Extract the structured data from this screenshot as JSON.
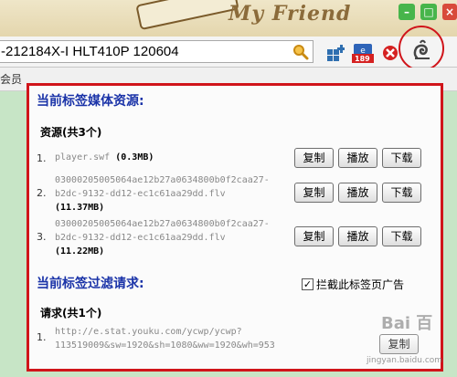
{
  "browser": {
    "theme_text": "My Friend",
    "url": "-212184X-I HLT410P 120604",
    "bookmark_text": "会员",
    "badge_number": "189"
  },
  "popup": {
    "media_title": "当前标签媒体资源:",
    "resources_heading": "资源(共3个)",
    "buttons": {
      "copy": "复制",
      "play": "播放",
      "download": "下载"
    },
    "resources": [
      {
        "index": "1.",
        "name": "player.swf",
        "size": "(0.3MB)"
      },
      {
        "index": "2.",
        "name_line1": "03000205005064ae12b27a0634800b0f2caa27-",
        "name_line2": "b2dc-9132-dd12-ec1c61aa29dd.flv",
        "size": "(11.37MB)"
      },
      {
        "index": "3.",
        "name_line1": "03000205005064ae12b27a0634800b0f2caa27-",
        "name_line2": "b2dc-9132-dd12-ec1c61aa29dd.flv",
        "size": "(11.22MB)"
      }
    ],
    "filter_title": "当前标签过滤请求:",
    "block_checkbox": {
      "label": "拦截此标签页广告",
      "checked": true
    },
    "requests_heading": "请求(共1个)",
    "requests": [
      {
        "index": "1.",
        "line1": "http://e.stat.youku.com/ycwp/ycwp?",
        "line2": "113519009&sw=1920&sh=1080&ww=1920&wh=953"
      }
    ],
    "request_button": "复制"
  },
  "watermark": {
    "logo": "Bai 百",
    "url": "jingyan.baidu.com"
  },
  "colors": {
    "highlight": "#d0141a",
    "section_title": "#1a33a8",
    "page_bg": "#c7e5c6"
  }
}
